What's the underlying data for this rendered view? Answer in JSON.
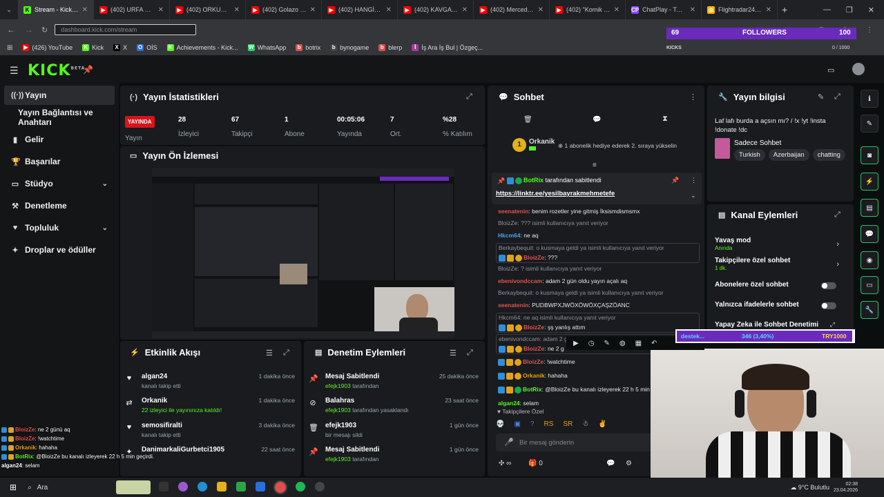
{
  "browser": {
    "tabs": [
      {
        "label": "Stream - Kick Dash",
        "fav": "K",
        "color": "#53fc18",
        "active": true
      },
      {
        "label": "(402) URFA SOKAKL",
        "fav": "▶",
        "color": "#ff0000"
      },
      {
        "label": "(402) ORKUN KÖ",
        "fav": "▶",
        "color": "#ff0000"
      },
      {
        "label": "(402) Golazo Cup",
        "fav": "▶",
        "color": "#ff0000"
      },
      {
        "label": "(402) HANGİSİ GE",
        "fav": "▶",
        "color": "#ff0000"
      },
      {
        "label": "(402) KAVGA Mİ E",
        "fav": "▶",
        "color": "#ff0000"
      },
      {
        "label": "(402) Mercedes C",
        "fav": "▶",
        "color": "#ff0000"
      },
      {
        "label": "(402) \"Komik Edit",
        "fav": "▶",
        "color": "#ff0000"
      },
      {
        "label": "ChatPlay - Twitch",
        "fav": "CP",
        "color": "#9146ff"
      },
      {
        "label": "Flightradar24: Live",
        "fav": "◎",
        "color": "#ffb400"
      }
    ],
    "url": "dashboard.kick.com/stream",
    "bookmarks": [
      {
        "label": "(426) YouTube",
        "icon": "youtube-icon",
        "color": "#ff0000",
        "glyph": "▶"
      },
      {
        "label": "Kick",
        "icon": "kick-icon",
        "color": "#53fc18",
        "glyph": "K"
      },
      {
        "label": "X",
        "icon": "x-icon",
        "color": "#000000",
        "glyph": "X"
      },
      {
        "label": "OİS",
        "icon": "ois-icon",
        "color": "#2a6fdb",
        "glyph": "O"
      },
      {
        "label": "Achievements - Kick...",
        "icon": "kick-icon",
        "color": "#53fc18",
        "glyph": "K"
      },
      {
        "label": "WhatsApp",
        "icon": "whatsapp-icon",
        "color": "#25d366",
        "glyph": "W"
      },
      {
        "label": "botrix",
        "icon": "botrix-icon",
        "color": "#e04d4d",
        "glyph": "b"
      },
      {
        "label": "bynogame",
        "icon": "bynogame-icon",
        "color": "#444",
        "glyph": "b"
      },
      {
        "label": "blerp",
        "icon": "blerp-icon",
        "color": "#e04d4d",
        "glyph": "b"
      },
      {
        "label": "İş Ara İş Bul | Özgeç...",
        "icon": "kariyer-icon",
        "color": "#a23c9c",
        "glyph": "İ"
      }
    ]
  },
  "overlay": {
    "followers_count": "69",
    "followers_label": "FOLLOWERS",
    "count_right": "100",
    "kicks_label": "KICKS",
    "kicks_progress": "0 / 1000",
    "destek_label": "destek...",
    "destek_value": "346 (3,40%)",
    "destek_goal": "TRY1000"
  },
  "sidebar": {
    "items": [
      {
        "label": "Yayın",
        "icon": "broadcast-icon",
        "glyph": "((·))"
      },
      {
        "label": "Yayın Bağlantısı ve Anahtarı",
        "icon": "",
        "glyph": ""
      },
      {
        "label": "Gelir",
        "icon": "revenue-icon",
        "glyph": "▮"
      },
      {
        "label": "Başarılar",
        "icon": "trophy-icon",
        "glyph": "🏆"
      },
      {
        "label": "Stüdyo",
        "icon": "studio-icon",
        "glyph": "▭"
      },
      {
        "label": "Denetleme",
        "icon": "gavel-icon",
        "glyph": "⚒"
      },
      {
        "label": "Topluluk",
        "icon": "community-icon",
        "glyph": "♥"
      },
      {
        "label": "Droplar ve ödüller",
        "icon": "gift-icon",
        "glyph": "✦"
      }
    ]
  },
  "stats": {
    "title": "Yayın İstatistikleri",
    "live_badge": "YAYINDA",
    "live_label": "Yayın",
    "items": [
      {
        "value": "28",
        "label": "İzleyici"
      },
      {
        "value": "67",
        "label": "Takipçi"
      },
      {
        "value": "1",
        "label": "Abone"
      },
      {
        "value": "00:05:06",
        "label": "Yayında"
      },
      {
        "value": "7",
        "label": "Ort."
      },
      {
        "value": "%28",
        "label": "% Katılım"
      }
    ]
  },
  "preview": {
    "title": "Yayın Ön İzlemesi"
  },
  "activity": {
    "title": "Etkinlik Akışı",
    "items": [
      {
        "name": "algan24",
        "sub": "kanalı takip etti",
        "time": "1 dakika önce",
        "icon": "heart-icon",
        "glyph": "♥"
      },
      {
        "name": "Orkanik",
        "sub": "22 izleyici ile yayınınıza katıldı!",
        "time": "1 dakika önce",
        "icon": "raid-icon",
        "glyph": "⇄"
      },
      {
        "name": "semosifiralti",
        "sub": "kanalı takip etti",
        "time": "3 dakika önce",
        "icon": "heart-icon",
        "glyph": "♥"
      },
      {
        "name": "DanimarkaliGurbetci1905",
        "sub": "",
        "time": "22 saat önce",
        "icon": "star-icon",
        "glyph": "✦"
      }
    ]
  },
  "moderation": {
    "title": "Denetim Eylemleri",
    "items": [
      {
        "name": "Mesaj Sabitlendi",
        "sub_user": "efejk1903",
        "sub": "tarafından",
        "time": "25 dakika önce",
        "icon": "pin-icon",
        "glyph": "📌"
      },
      {
        "name": "Balahras",
        "sub_user": "efejk1903",
        "sub": "tarafından yasaklandı",
        "time": "23 saat önce",
        "icon": "ban-icon",
        "glyph": "⊘"
      },
      {
        "name": "efejk1903",
        "sub_user": "",
        "sub": "bir mesajı sildi",
        "time": "1 gün önce",
        "icon": "trash-icon",
        "glyph": "🗑"
      },
      {
        "name": "Mesaj Sabitlendi",
        "sub_user": "efejk1903",
        "sub": "tarafından",
        "time": "1 gün önce",
        "icon": "pin-icon",
        "glyph": "📌"
      }
    ]
  },
  "chat": {
    "title": "Sohbet",
    "top_user": "Orkanik",
    "top_user_count": "1",
    "gift_text": "1 abonelik hediye ederek 2. sıraya yükselin",
    "pinned_by": "BotRix",
    "pinned_suffix": "tarafından sabitlendi",
    "pinned_link": "https://linktr.ee/yesilbayrakmehmetefe",
    "messages": [
      {
        "reply": "",
        "user": "seenatenin",
        "color": "#e0534f",
        "text": ": benim rozetler yine gitmiş İksismdismsmx"
      },
      {
        "reply": "BloizZe: ??? isimli kullanıcıya yanıt veriyor",
        "user": "",
        "color": "",
        "text": ""
      },
      {
        "reply": "",
        "user": "Hkcm64",
        "color": "#4ea0e8",
        "text": ": ne aq"
      },
      {
        "reply": "Berkaybequit: o kusmaya geldi ya isimli kullanıcıya yanıt veriyor",
        "user": "BloizZe",
        "color": "#e0534f",
        "text": ": ???"
      },
      {
        "reply": "BloizZe: ? isimli kullanıcıya yanıt veriyor",
        "user": "",
        "color": "",
        "text": ""
      },
      {
        "reply": "",
        "user": "ebenivondccam",
        "color": "#e0534f",
        "text": ": adam 2 gün oldu yayın açalı aq"
      },
      {
        "reply": "Berkaybequit: o kusmaya geldi ya isimli kullanıcıya yanıt veriyor",
        "user": "",
        "color": "",
        "text": ""
      },
      {
        "reply": "",
        "user": "seenatenin",
        "color": "#e0534f",
        "text": ": PUDBWPXJWÖXÖWÖXÇAŞZÖANC"
      },
      {
        "reply": "Hkcm64: ne aq isimli kullanıcıya yanıt veriyor",
        "user": "BloizZe",
        "color": "#e0534f",
        "text": ": şş yanlış attım"
      },
      {
        "reply": "ebenivondccam: adam 2 gün oldu yayın açalı aq isimli kullanıcıya",
        "user": "BloizZe",
        "color": "#e0534f",
        "text": ": ne 2 g"
      },
      {
        "reply": "",
        "user": "BloizZe",
        "color": "#e0534f",
        "text": ": !watchtime"
      },
      {
        "reply": "",
        "user": "Orkanik",
        "color": "#e3a21a",
        "text": ": hahaha"
      },
      {
        "reply": "",
        "user": "BotRix",
        "color": "#53fc18",
        "text": ": @BloizZe bu kanalı izleyerek 22 h 5 min"
      },
      {
        "reply": "",
        "user": "algan24",
        "color": "#53fc18",
        "text": ": selam"
      }
    ],
    "followers_only": "Takipçilere Özel",
    "input_placeholder": "Bir mesaj gönderin",
    "points": "∞",
    "gift_count": "0"
  },
  "info": {
    "title": "Yayın bilgisi",
    "stream_title": "Laf lafı burda a açsın mı? / !x !yt !insta !donate !dc",
    "category": "Sadece Sohbet",
    "tags": [
      "Turkish",
      "Azerbaijan",
      "chatting"
    ]
  },
  "channel_actions": {
    "title": "Kanal Eylemleri",
    "items": [
      {
        "label": "Yavaş mod",
        "sub": "Anında",
        "control": "chevron"
      },
      {
        "label": "Takipçilere özel sohbet",
        "sub": "1 dk.",
        "control": "chevron"
      },
      {
        "label": "Abonelere özel sohbet",
        "sub": "",
        "control": "toggle"
      },
      {
        "label": "Yalnızca ifadelerle sohbet",
        "sub": "",
        "control": "toggle"
      },
      {
        "label": "Yapay Zeka ile Sohbet Denetimi",
        "sub": "",
        "control": "link"
      }
    ]
  },
  "overlay_chat": [
    {
      "user": "BloizZe",
      "color": "#e0534f",
      "text": ": ne 2 günü aq"
    },
    {
      "user": "BloizZe",
      "color": "#e0534f",
      "text": ": !watchtime"
    },
    {
      "user": "Orkanik",
      "color": "#e3a21a",
      "text": ": hahaha"
    },
    {
      "user": "BotRix",
      "color": "#53fc18",
      "text": ": @BloizZe bu kanalı izleyerek 22 h 5 min geçirdi."
    },
    {
      "user": "algan24",
      "color": "#ffffff",
      "text": ": selam"
    }
  ],
  "taskbar": {
    "search": "Ara",
    "weather": "9°C Bulutlu",
    "time": "02:38",
    "date": "23.04.2026"
  }
}
